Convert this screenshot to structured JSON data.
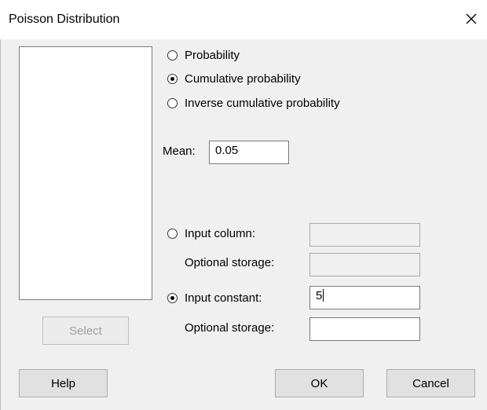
{
  "window": {
    "title": "Poisson Distribution"
  },
  "variables_list": {
    "items": []
  },
  "select_button": {
    "label": "Select",
    "enabled": false
  },
  "mode": {
    "selected": "cumulative",
    "options": [
      {
        "key": "probability",
        "label": "Probability",
        "checked": false
      },
      {
        "key": "cumulative",
        "label": "Cumulative probability",
        "checked": true
      },
      {
        "key": "inverse",
        "label": "Inverse cumulative probability",
        "checked": false
      }
    ]
  },
  "mean": {
    "label": "Mean:",
    "value": "0.05"
  },
  "input_column": {
    "label": "Input column:",
    "checked": false,
    "value": "",
    "storage_label": "Optional storage:",
    "storage_value": ""
  },
  "input_constant": {
    "label": "Input constant:",
    "checked": true,
    "value": "5",
    "storage_label": "Optional storage:",
    "storage_value": ""
  },
  "footer": {
    "help_label": "Help",
    "ok_label": "OK",
    "cancel_label": "Cancel"
  }
}
